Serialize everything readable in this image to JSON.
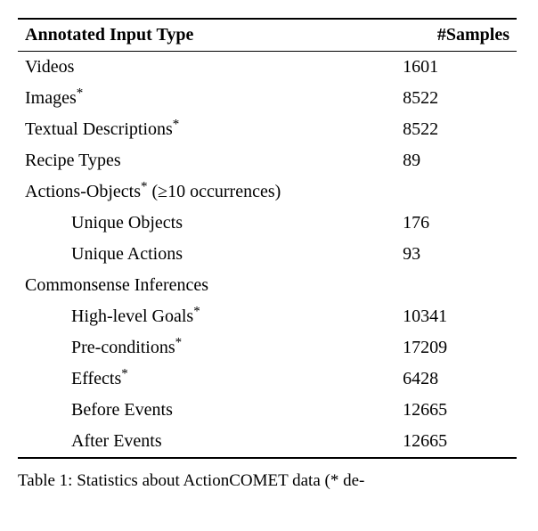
{
  "headers": {
    "col1": "Annotated Input Type",
    "col2": "#Samples"
  },
  "rows": {
    "videos": {
      "label": "Videos",
      "value": "1601"
    },
    "images": {
      "label": "Images",
      "sup": "*",
      "value": "8522"
    },
    "textual": {
      "label": "Textual Descriptions",
      "sup": "*",
      "value": "8522"
    },
    "recipe": {
      "label": "Recipe Types",
      "value": "89"
    },
    "actions_objects": {
      "label": "Actions-Objects",
      "sup": "*",
      "suffix": " (≥10 occurrences)",
      "value": ""
    },
    "unique_objects": {
      "label": "Unique Objects",
      "value": "176"
    },
    "unique_actions": {
      "label": "Unique Actions",
      "value": "93"
    },
    "commonsense": {
      "label": "Commonsense Inferences",
      "value": ""
    },
    "high_level": {
      "label": "High-level Goals",
      "sup": "*",
      "value": "10341"
    },
    "preconditions": {
      "label": "Pre-conditions",
      "sup": "*",
      "value": "17209"
    },
    "effects": {
      "label": "Effects",
      "sup": "*",
      "value": "6428"
    },
    "before": {
      "label": "Before Events",
      "value": "12665"
    },
    "after": {
      "label": "After Events",
      "value": "12665"
    }
  },
  "caption": "Table 1: Statistics about ActionCOMET data (* de-"
}
